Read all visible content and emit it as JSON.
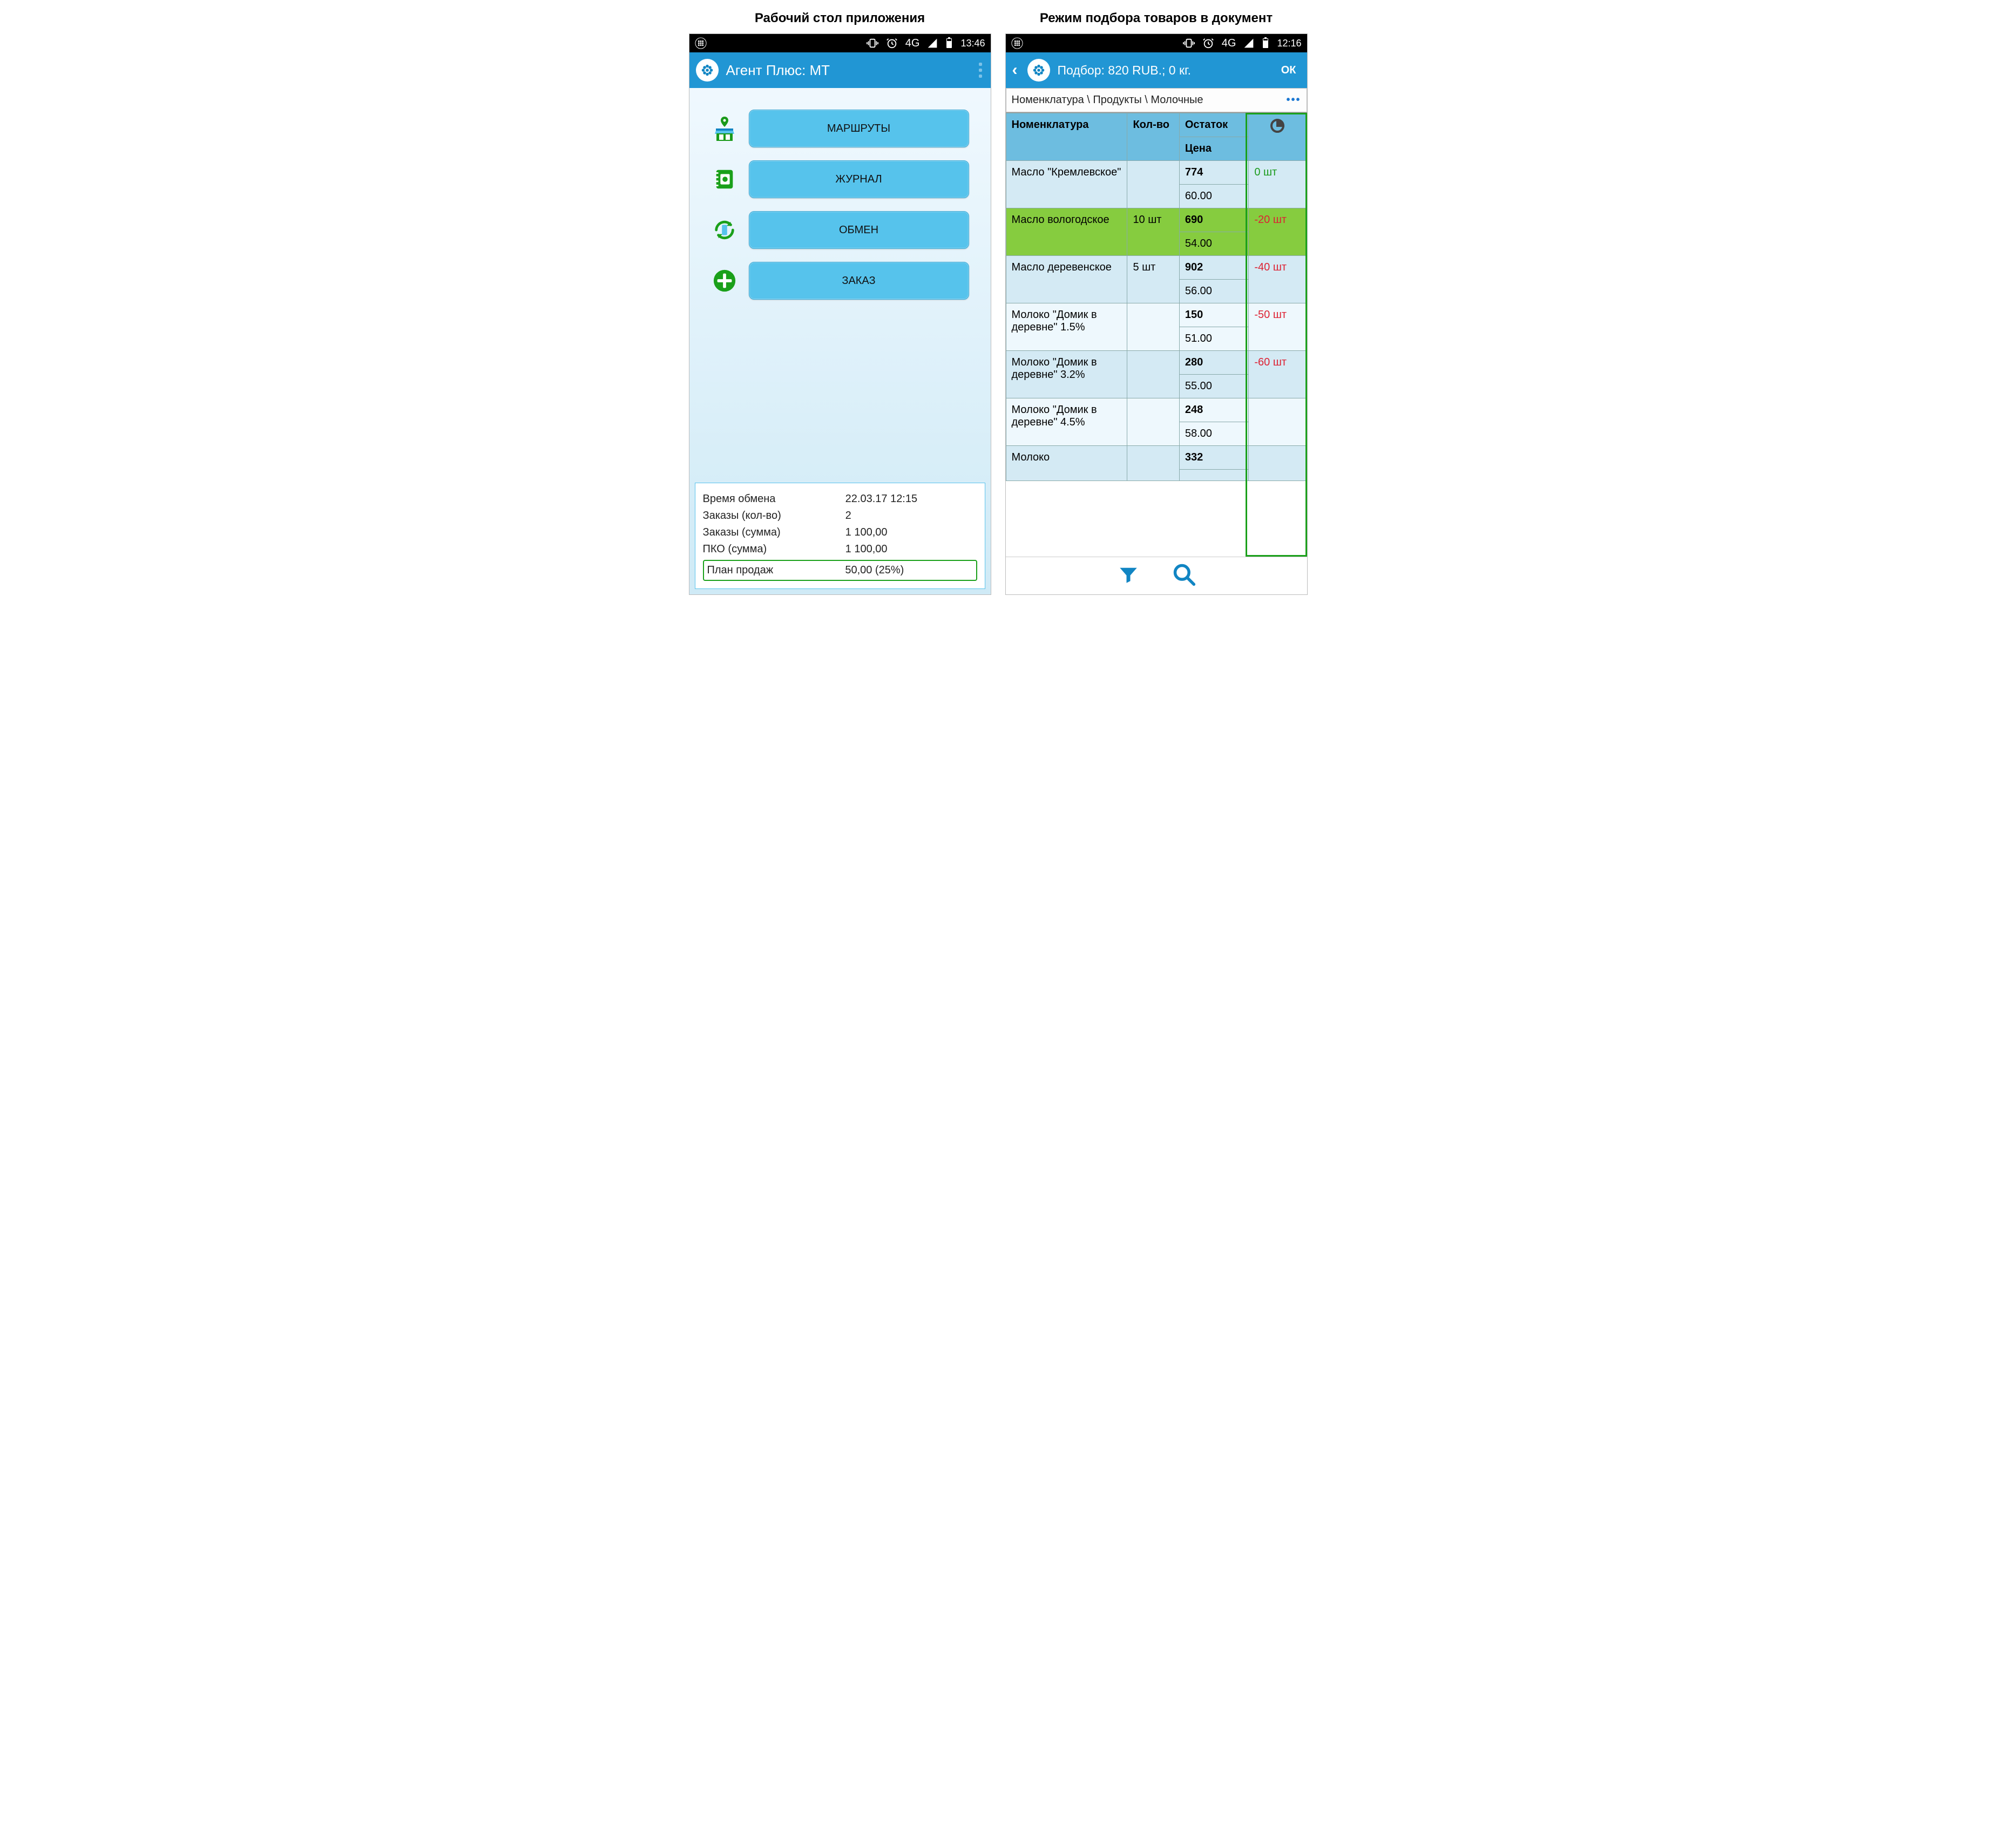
{
  "left": {
    "title": "Рабочий стол приложения",
    "status": {
      "time": "13:46",
      "net": "4G"
    },
    "header": {
      "app_title": "Агент Плюс: МТ"
    },
    "menu": {
      "routes": "МАРШРУТЫ",
      "journal": "ЖУРНАЛ",
      "exchange": "ОБМЕН",
      "order": "ЗАКАЗ"
    },
    "stats": {
      "exchange_time_label": "Время обмена",
      "exchange_time": "22.03.17 12:15",
      "orders_count_label": "Заказы (кол-во)",
      "orders_count": "2",
      "orders_sum_label": "Заказы (сумма)",
      "orders_sum": "1 100,00",
      "pko_sum_label": "ПКО (сумма)",
      "pko_sum": "1 100,00",
      "plan_label": "План продаж",
      "plan_value": "50,00 (25%)"
    }
  },
  "right": {
    "title": "Режим подбора товаров в документ",
    "status": {
      "time": "12:16",
      "net": "4G"
    },
    "header": {
      "title": "Подбор: 820 RUB.; 0 кг.",
      "ok": "ОК"
    },
    "breadcrumb": "Номенклатура \\ Продукты \\ Молочные",
    "columns": {
      "name": "Номенклатура",
      "qty": "Кол-во",
      "stock": "Остаток",
      "price": "Цена"
    },
    "rows": [
      {
        "name": "Масло \"Кремлевское\"",
        "qty": "",
        "stock": "774",
        "price": "60.00",
        "ind": "0 шт",
        "ind_class": "zero",
        "sel": false,
        "odd": false
      },
      {
        "name": "Масло вологодское",
        "qty": "10 шт",
        "stock": "690",
        "price": "54.00",
        "ind": "-20 шт",
        "ind_class": "neg",
        "sel": true,
        "odd": true
      },
      {
        "name": "Масло деревенское",
        "qty": "5 шт",
        "stock": "902",
        "price": "56.00",
        "ind": "-40 шт",
        "ind_class": "neg",
        "sel": false,
        "odd": false
      },
      {
        "name": "Молоко \"Домик в деревне\" 1.5%",
        "qty": "",
        "stock": "150",
        "price": "51.00",
        "ind": "-50 шт",
        "ind_class": "neg",
        "sel": false,
        "odd": true
      },
      {
        "name": "Молоко \"Домик в деревне\" 3.2%",
        "qty": "",
        "stock": "280",
        "price": "55.00",
        "ind": "-60 шт",
        "ind_class": "neg",
        "sel": false,
        "odd": false
      },
      {
        "name": "Молоко \"Домик в деревне\" 4.5%",
        "qty": "",
        "stock": "248",
        "price": "58.00",
        "ind": "",
        "ind_class": "",
        "sel": false,
        "odd": true
      },
      {
        "name": "Молоко",
        "qty": "",
        "stock": "332",
        "price": "",
        "ind": "",
        "ind_class": "",
        "sel": false,
        "odd": false
      }
    ]
  }
}
